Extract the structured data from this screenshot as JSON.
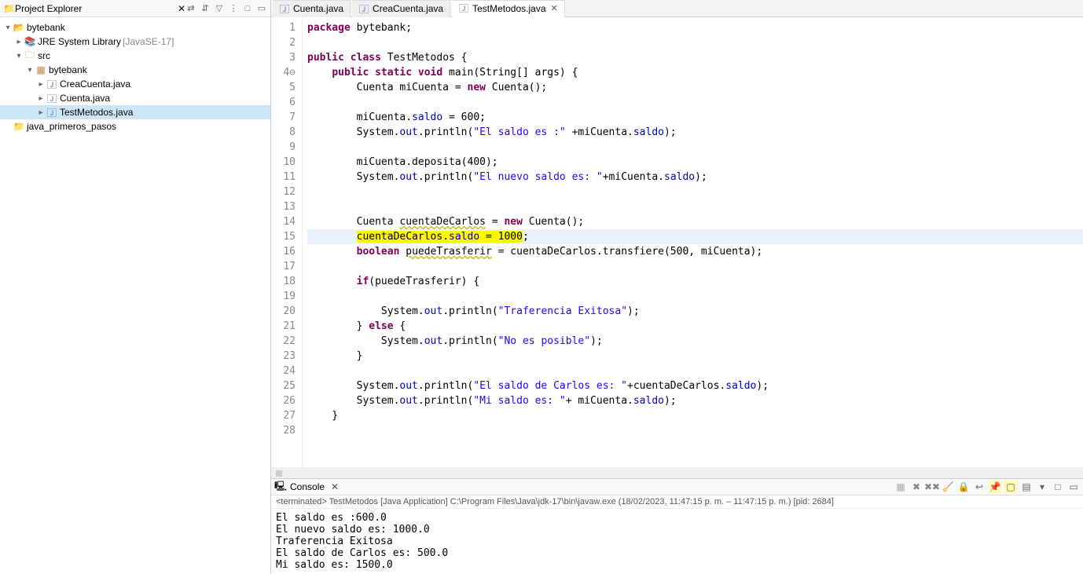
{
  "explorer": {
    "title": "Project Explorer",
    "toolbar_icons": [
      "⇄",
      "⇵",
      "▽",
      "⋮",
      "□",
      "▭"
    ]
  },
  "tree": {
    "items": [
      {
        "indent": 0,
        "twisty": "▾",
        "icon": "project",
        "label": "bytebank",
        "selected": false
      },
      {
        "indent": 1,
        "twisty": "▸",
        "icon": "jar",
        "label": "JRE System Library",
        "suffix": "[JavaSE-17]",
        "selected": false
      },
      {
        "indent": 1,
        "twisty": "▾",
        "icon": "srcfolder",
        "label": "src",
        "selected": false
      },
      {
        "indent": 2,
        "twisty": "▾",
        "icon": "pkg",
        "label": "bytebank",
        "selected": false
      },
      {
        "indent": 3,
        "twisty": "▸",
        "icon": "java",
        "label": "CreaCuenta.java",
        "selected": false
      },
      {
        "indent": 3,
        "twisty": "▸",
        "icon": "java",
        "label": "Cuenta.java",
        "selected": false
      },
      {
        "indent": 3,
        "twisty": "▸",
        "icon": "java",
        "label": "TestMetodos.java",
        "selected": true
      },
      {
        "indent": 0,
        "twisty": "",
        "icon": "folder",
        "label": "java_primeros_pasos",
        "selected": false
      }
    ]
  },
  "tabs": [
    {
      "label": "Cuenta.java",
      "active": false
    },
    {
      "label": "CreaCuenta.java",
      "active": false
    },
    {
      "label": "TestMetodos.java",
      "active": true
    }
  ],
  "code": {
    "lines": [
      {
        "n": "1",
        "html": "<span class='kw'>package</span> bytebank;"
      },
      {
        "n": "2",
        "html": ""
      },
      {
        "n": "3",
        "html": "<span class='kw'>public</span> <span class='kw'>class</span> TestMetodos {"
      },
      {
        "n": "4⊖",
        "html": "    <span class='kw'>public</span> <span class='kw'>static</span> <span class='kw'>void</span> main(String[] args) {"
      },
      {
        "n": "5",
        "html": "        Cuenta miCuenta = <span class='kw'>new</span> Cuenta();"
      },
      {
        "n": "6",
        "html": ""
      },
      {
        "n": "7",
        "html": "        miCuenta.<span class='field'>saldo</span> = 600;"
      },
      {
        "n": "8",
        "html": "        System.<span class='field'>out</span>.println(<span class='str'>\"El saldo es :\"</span> +miCuenta.<span class='field'>saldo</span>);"
      },
      {
        "n": "9",
        "html": ""
      },
      {
        "n": "10",
        "html": "        miCuenta.deposita(400);"
      },
      {
        "n": "11",
        "html": "        System.<span class='field'>out</span>.println(<span class='str'>\"El nuevo saldo es: \"</span>+miCuenta.<span class='field'>saldo</span>);"
      },
      {
        "n": "12",
        "html": ""
      },
      {
        "n": "13",
        "html": ""
      },
      {
        "n": "14",
        "html": "        Cuenta <span class='underline-err'>cuentaDeCarlos</span> = <span class='kw'>new</span> Cuenta();"
      },
      {
        "n": "15",
        "html": "        <span class='yellow-hl'>cuentaDeCarlos.<span class='field'>saldo</span> = 1000</span>;",
        "hl": true
      },
      {
        "n": "16",
        "html": "        <span class='kw'>boolean</span> <span class='underline-err'>puedeTrasferir</span> = cuentaDeCarlos.transfiere(500, miCuenta);"
      },
      {
        "n": "17",
        "html": ""
      },
      {
        "n": "18",
        "html": "        <span class='kw'>if</span>(puedeTrasferir) {"
      },
      {
        "n": "19",
        "html": ""
      },
      {
        "n": "20",
        "html": "            System.<span class='field'>out</span>.println(<span class='str'>\"Traferencia Exitosa\"</span>);"
      },
      {
        "n": "21",
        "html": "        } <span class='kw'>else</span> {"
      },
      {
        "n": "22",
        "html": "            System.<span class='field'>out</span>.println(<span class='str'>\"No es posible\"</span>);"
      },
      {
        "n": "23",
        "html": "        }"
      },
      {
        "n": "24",
        "html": ""
      },
      {
        "n": "25",
        "html": "        System.<span class='field'>out</span>.println(<span class='str'>\"El saldo de Carlos es: \"</span>+cuentaDeCarlos.<span class='field'>saldo</span>);"
      },
      {
        "n": "26",
        "html": "        System.<span class='field'>out</span>.println(<span class='str'>\"Mi saldo es: \"</span>+ miCuenta.<span class='field'>saldo</span>);"
      },
      {
        "n": "27",
        "html": "    }"
      },
      {
        "n": "28",
        "html": ""
      }
    ]
  },
  "console": {
    "title": "Console",
    "info": "<terminated> TestMetodos [Java Application] C:\\Program Files\\Java\\jdk-17\\bin\\javaw.exe  (18/02/2023, 11:47:15 p. m. – 11:47:15 p. m.) [pid: 2684]",
    "output": "El saldo es :600.0\nEl nuevo saldo es: 1000.0\nTraferencia Exitosa\nEl saldo de Carlos es: 500.0\nMi saldo es: 1500.0"
  }
}
